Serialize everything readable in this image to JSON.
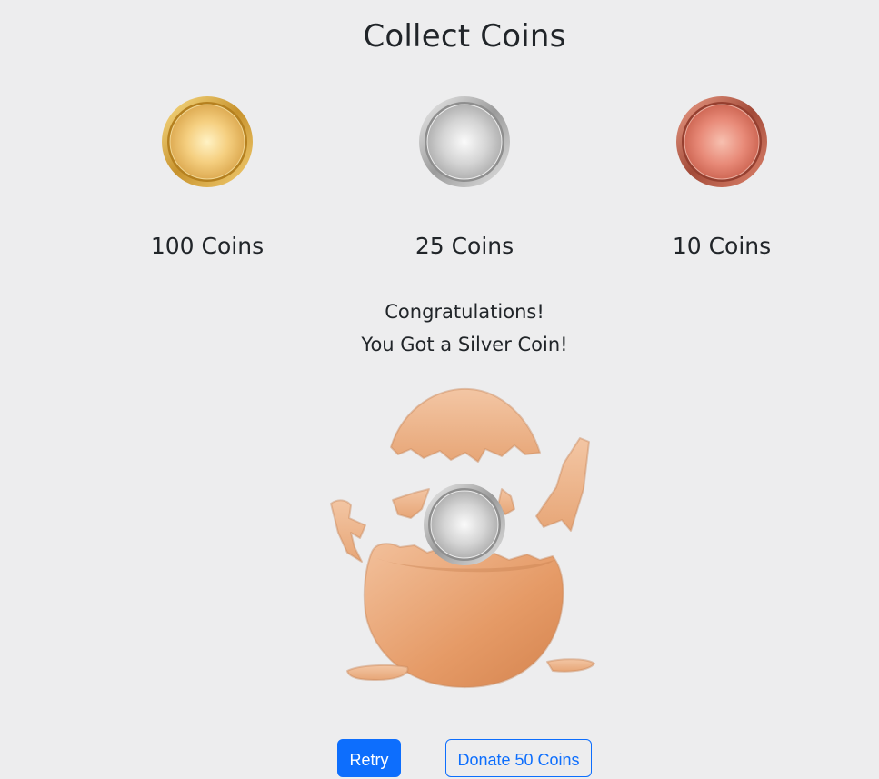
{
  "page": {
    "title": "Collect Coins"
  },
  "coins": [
    {
      "icon": "gold-coin-icon",
      "label": "100 Coins",
      "color": "#f2c46c"
    },
    {
      "icon": "silver-coin-icon",
      "label": "25 Coins",
      "color": "#c9c9c9"
    },
    {
      "icon": "bronze-coin-icon",
      "label": "10 Coins",
      "color": "#e07f6c"
    }
  ],
  "result": {
    "line1": "Congratulations!",
    "line2": "You Got a Silver Coin!",
    "coin_icon": "silver-coin-icon",
    "scene_icon": "cracked-egg-icon"
  },
  "actions": {
    "retry_label": "Retry",
    "donate_label": "Donate 50 Coins"
  },
  "colors": {
    "background": "#ededee",
    "primary": "#0d6efd",
    "egg": "#e49b68",
    "text": "#212529"
  }
}
